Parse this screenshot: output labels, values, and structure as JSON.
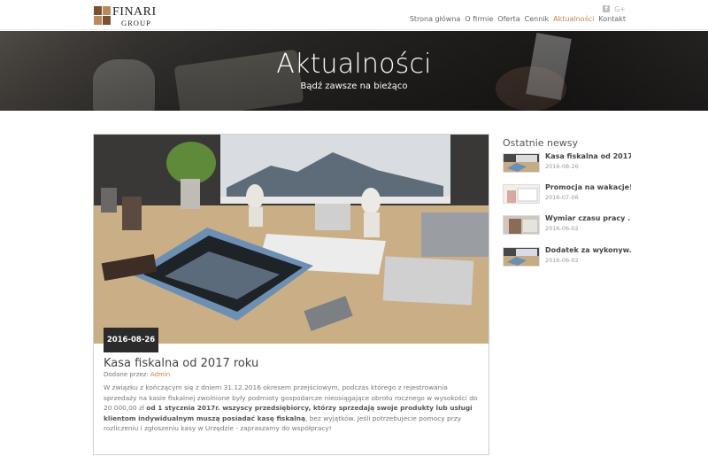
{
  "logo": {
    "line1": "FINARI",
    "line2": "GROUP",
    "brand_color": "#7a5230"
  },
  "social": {
    "facebook_icon": "facebook-icon",
    "googleplus_label": "G+"
  },
  "nav": {
    "items": [
      {
        "label": "Strona główna"
      },
      {
        "label": "O firmie"
      },
      {
        "label": "Oferta"
      },
      {
        "label": "Cennik"
      },
      {
        "label": "Aktualności",
        "active": true
      },
      {
        "label": "Kontakt"
      }
    ],
    "accent_color": "#c8834a"
  },
  "hero": {
    "title": "Aktualności",
    "subtitle": "Bądź zawsze na bieżąco"
  },
  "article": {
    "date": "2016-08-26",
    "title": "Kasa fiskalna od 2017 roku",
    "meta_prefix": "Dodane przez: ",
    "author": "Admin",
    "body_part1": "W związku z kończącym się z dniem 31.12.2016 okresem przejściowym, podczas którego z rejestrowania sprzedaży na kasie fiskalnej zwolnione były podmioty gospodarcze nieosiągające obrotu rocznego w wysokości do 20 000,00 zł ",
    "body_bold": "od 1 stycznia 2017r. wszyscy przedsiębiorcy, którzy sprzedają swoje produkty lub usługi klientom indywidualnym muszą posiadać kasę fiskalną",
    "body_part2": ", bez wyjątków. Jeśli potrzebujecie pomocy przy rozliczeniu i zgłoszeniu kasy w Urzędzie - zapraszamy do współpracy!"
  },
  "sidebar": {
    "title": "Ostatnie newsy",
    "items": [
      {
        "title": "Kasa fiskalna od 2017 ...",
        "date": "2016-08-26"
      },
      {
        "title": "Promocja na wakacje!",
        "date": "2016-07-06"
      },
      {
        "title": "Wymiar czasu pracy ...",
        "date": "2016-06-02"
      },
      {
        "title": "Dodatek za wykonyw...",
        "date": "2016-06-02"
      }
    ]
  }
}
